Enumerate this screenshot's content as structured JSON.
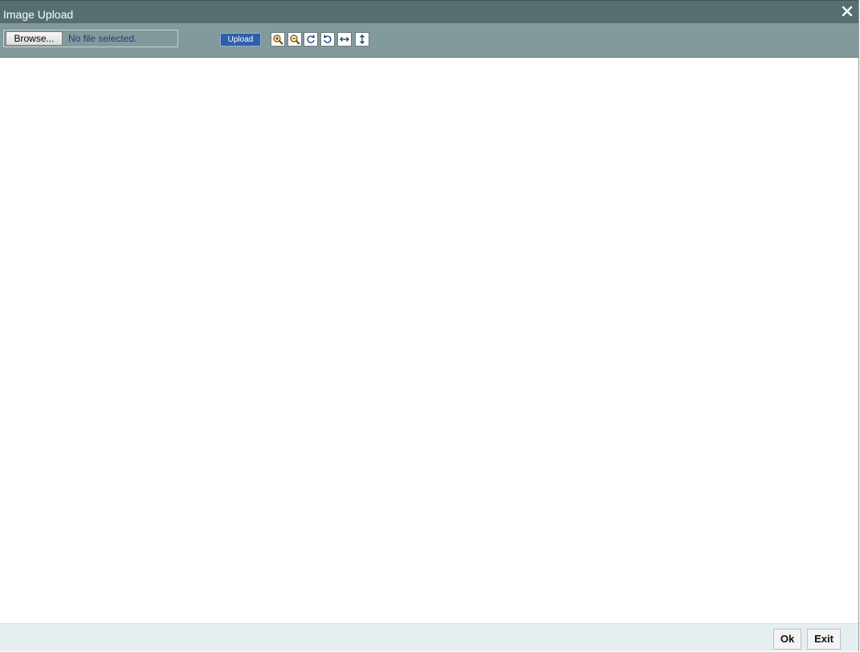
{
  "window": {
    "title": "Image Upload",
    "close_icon": "close-icon"
  },
  "toolbar": {
    "browse_label": "Browse...",
    "file_status": "No file selected.",
    "upload_label": "Upload",
    "tools": [
      {
        "icon": "zoom-in-icon"
      },
      {
        "icon": "zoom-out-icon"
      },
      {
        "icon": "rotate-clockwise-icon"
      },
      {
        "icon": "rotate-counterclockwise-icon"
      },
      {
        "icon": "flip-horizontal-icon"
      },
      {
        "icon": "flip-vertical-icon"
      }
    ]
  },
  "footer": {
    "ok_label": "Ok",
    "exit_label": "Exit"
  },
  "colors": {
    "titlebar": "#566e71",
    "toolbar": "#839a9c",
    "upload_button": "#2f5fa8",
    "footer": "#e5eef0"
  }
}
